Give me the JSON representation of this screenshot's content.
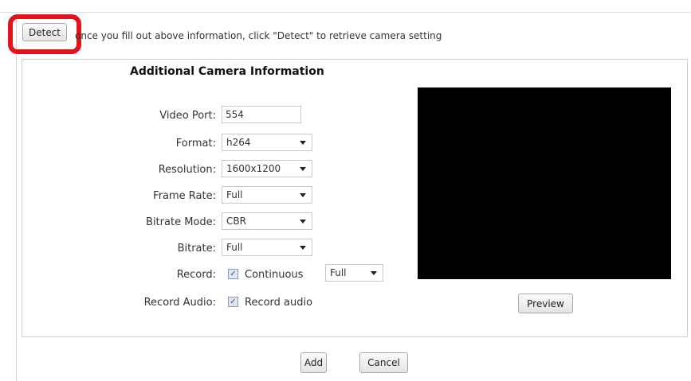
{
  "detect": {
    "button_label": "Detect",
    "hint": "once you fill out above information, click \"Detect\" to retrieve camera setting",
    "highlight_color": "#e0141a"
  },
  "section": {
    "title": "Additional Camera Information"
  },
  "fields": {
    "video_port": {
      "label": "Video Port:",
      "value": "554"
    },
    "format": {
      "label": "Format:",
      "value": "h264"
    },
    "resolution": {
      "label": "Resolution:",
      "value": "1600x1200"
    },
    "frame_rate": {
      "label": "Frame Rate:",
      "value": "Full"
    },
    "bitrate_mode": {
      "label": "Bitrate Mode:",
      "value": "CBR"
    },
    "bitrate": {
      "label": "Bitrate:",
      "value": "Full"
    },
    "record": {
      "label": "Record:",
      "checkbox_label": "Continuous",
      "checked": true,
      "quality": "Full"
    },
    "record_audio": {
      "label": "Record Audio:",
      "checkbox_label": "Record audio",
      "checked": true
    }
  },
  "preview": {
    "button_label": "Preview",
    "background": "#000000"
  },
  "footer": {
    "add_label": "Add",
    "cancel_label": "Cancel"
  }
}
